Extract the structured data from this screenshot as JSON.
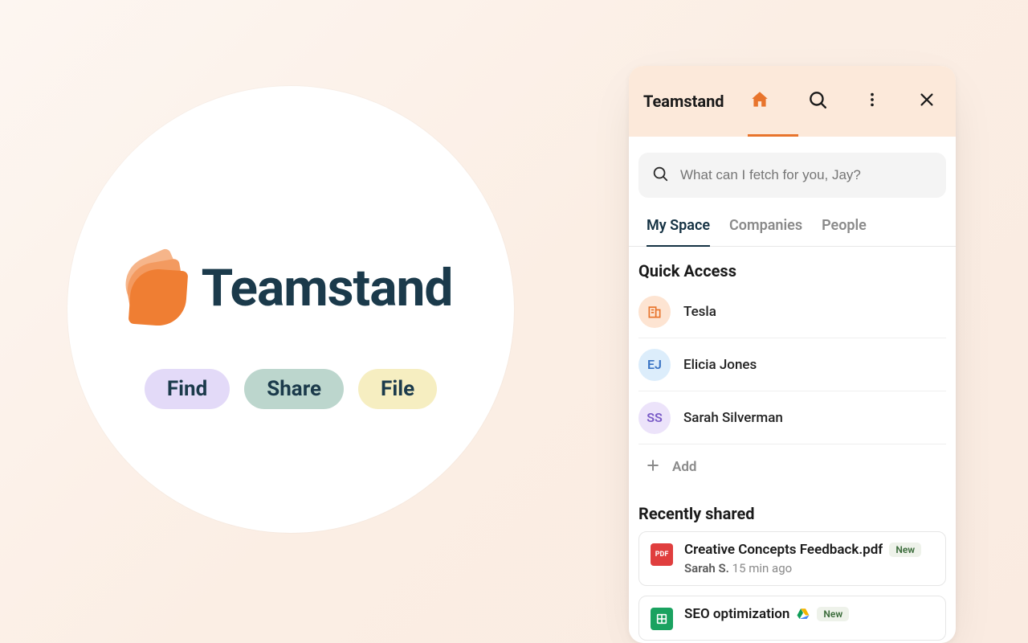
{
  "promo": {
    "brand": "Teamstand",
    "pills": {
      "find": "Find",
      "share": "Share",
      "file": "File"
    }
  },
  "app": {
    "title": "Teamstand",
    "search": {
      "placeholder": "What can I fetch for you, Jay?"
    },
    "tabs": {
      "my_space": "My Space",
      "companies": "Companies",
      "people": "People"
    },
    "quick_access": {
      "title": "Quick Access",
      "items": [
        {
          "label": "Tesla",
          "avatar_text": "",
          "kind": "company"
        },
        {
          "label": "Elicia Jones",
          "avatar_text": "EJ",
          "kind": "person"
        },
        {
          "label": "Sarah Silverman",
          "avatar_text": "SS",
          "kind": "person"
        }
      ],
      "add_label": "Add"
    },
    "recent": {
      "title": "Recently shared",
      "items": [
        {
          "icon": "pdf",
          "icon_text": "PDF",
          "title": "Creative Concepts Feedback.pdf",
          "badge": "New",
          "by": "Sarah S.",
          "when": "15 min ago",
          "has_drive": false
        },
        {
          "icon": "sheet",
          "icon_text": "",
          "title": "SEO optimization",
          "badge": "New",
          "by": "",
          "when": "",
          "has_drive": true
        }
      ]
    }
  }
}
